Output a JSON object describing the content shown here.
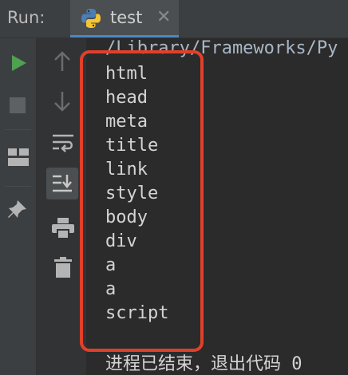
{
  "header": {
    "run_label": "Run:",
    "tab_label": "test",
    "tab_close": "✕"
  },
  "toolbar": {
    "left_icons": [
      "run-icon",
      "stop-icon",
      "layout-icon",
      "pin-icon"
    ],
    "right_icons": [
      "arrow-up-icon",
      "arrow-down-icon",
      "soft-wrap-icon",
      "scroll-to-end-icon",
      "print-icon",
      "trash-icon"
    ]
  },
  "console": {
    "path": "/Library/Frameworks/Py",
    "lines": [
      "html",
      "head",
      "meta",
      "title",
      "link",
      "style",
      "body",
      "div",
      "a",
      "a",
      "script"
    ],
    "exit_message": "进程已结束，退出代码 0"
  },
  "colors": {
    "run_green": "#4fa04f",
    "highlight_red": "#e0402a",
    "tab_underline": "#4a88c7"
  }
}
